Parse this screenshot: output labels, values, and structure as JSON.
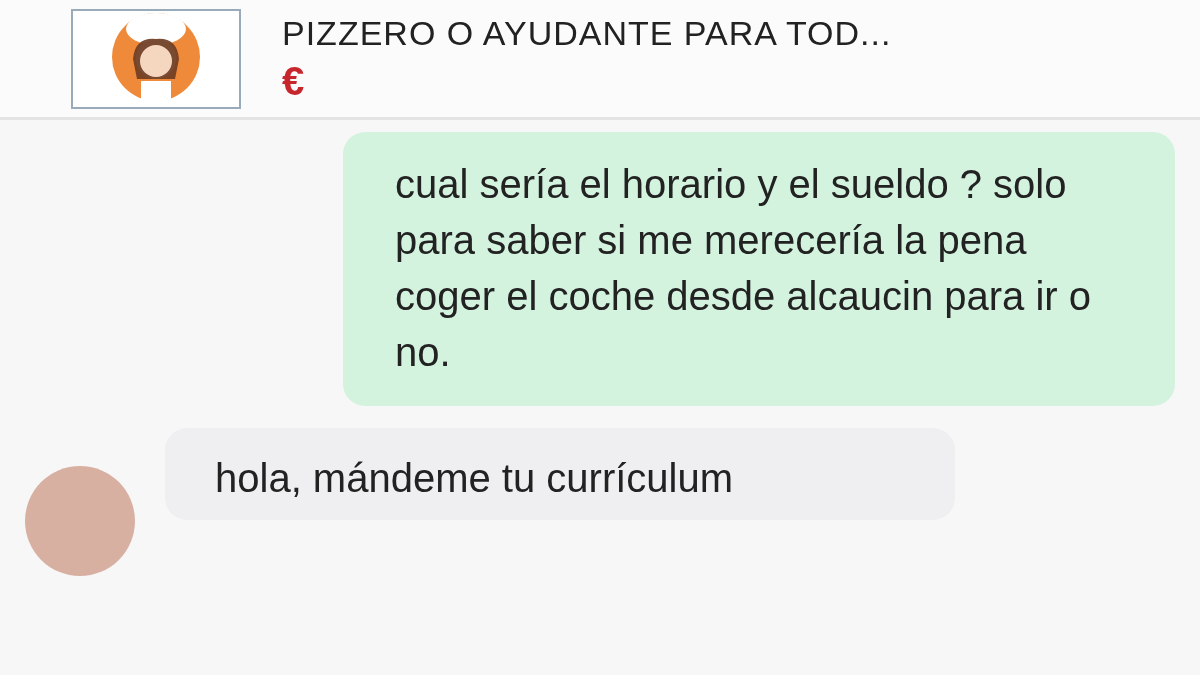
{
  "listing": {
    "title": "PIZZERO O AYUDANTE PARA TOD...",
    "price": "€"
  },
  "messages": [
    {
      "kind": "sent",
      "text": "cual sería el horario y el sueldo ? solo para saber si me merecería la pena coger el coche desde alcaucin para ir o no."
    },
    {
      "kind": "received",
      "text": "hola, mándeme tu currículum"
    }
  ]
}
